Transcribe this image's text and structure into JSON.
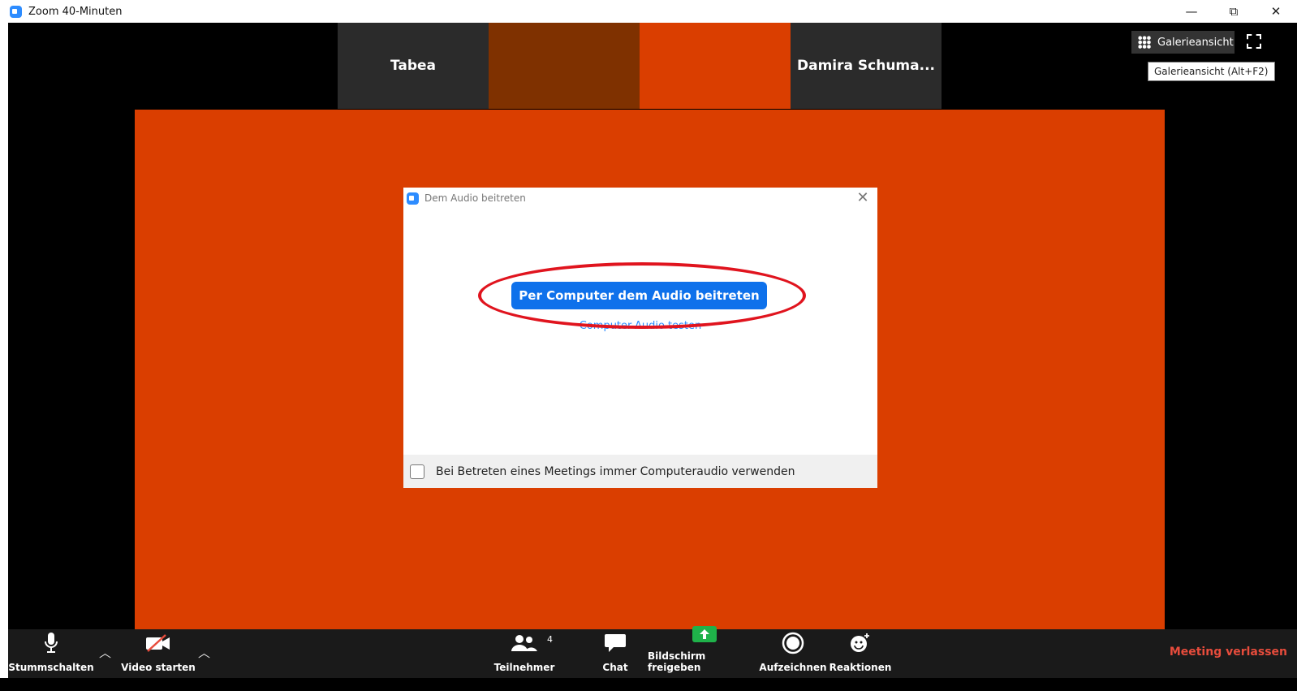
{
  "window": {
    "title": "Zoom 40-Minuten",
    "minimize": "—",
    "restore": "⧉",
    "close": "✕"
  },
  "tiles": [
    {
      "name": "Tabea",
      "color": "#2b2b2b"
    },
    {
      "name": "",
      "color": "#7f3100"
    },
    {
      "name": "",
      "color": "#da3e00"
    },
    {
      "name": "Damira  Schuma...",
      "color": "#2b2b2b"
    }
  ],
  "view": {
    "gallery_label": "Galerieansicht",
    "tooltip": "Galerieansicht (Alt+F2)"
  },
  "dialog": {
    "title": "Dem Audio beitreten",
    "join_button": "Per Computer dem Audio beitreten",
    "test_link": "Computer-Audio testen",
    "checkbox_label": "Bei Betreten eines Meetings immer Computeraudio verwenden"
  },
  "toolbar": {
    "mute": "Stummschalten",
    "video": "Video starten",
    "participants": "Teilnehmer",
    "participant_count": "4",
    "chat": "Chat",
    "share": "Bildschirm freigeben",
    "record": "Aufzeichnen",
    "reactions": "Reaktionen",
    "leave": "Meeting verlassen"
  },
  "colors": {
    "accent": "#0e71eb",
    "main_video": "#da3e00",
    "leave": "#e74c3c",
    "annotation": "#e0141e"
  }
}
